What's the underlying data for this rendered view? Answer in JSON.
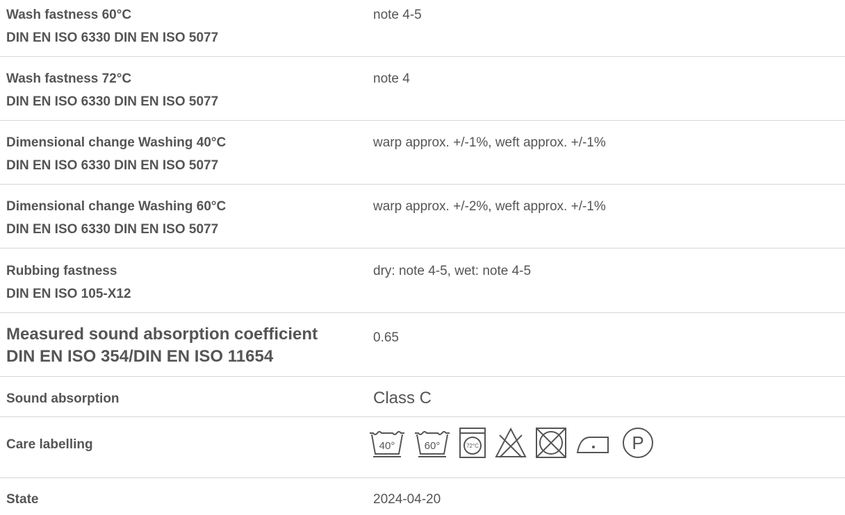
{
  "rows": [
    {
      "label1": "Wash fastness 60°C",
      "label2": "DIN EN ISO 6330 DIN EN ISO 5077",
      "value": "note 4-5"
    },
    {
      "label1": "Wash fastness 72°C",
      "label2": "DIN EN ISO 6330 DIN EN ISO 5077",
      "value": "note 4"
    },
    {
      "label1": "Dimensional change Washing 40°C",
      "label2": "DIN EN ISO 6330 DIN EN ISO 5077",
      "value": "warp approx. +/-1%, weft approx. +/-1%"
    },
    {
      "label1": "Dimensional change Washing 60°C",
      "label2": "DIN EN ISO 6330 DIN EN ISO 5077",
      "value": "warp approx. +/-2%, weft approx. +/-1%"
    },
    {
      "label1": "Rubbing fastness",
      "label2": "DIN EN ISO 105-X12",
      "value": "dry: note 4-5, wet: note 4-5"
    },
    {
      "label1": "Measured sound absorption coefficient",
      "label2": "DIN EN ISO 354/DIN EN ISO 11654",
      "value": "0.65"
    },
    {
      "label1": "Sound absorption",
      "value": "Class C"
    },
    {
      "label1": "Care labelling"
    },
    {
      "label1": "State",
      "value": "2024-04-20"
    }
  ],
  "care_icons": [
    {
      "name": "wash-40-icon",
      "text": "40°"
    },
    {
      "name": "wash-60-icon",
      "text": "60°"
    },
    {
      "name": "tumble-dry-72-icon",
      "text": "72°C"
    },
    {
      "name": "do-not-bleach-icon"
    },
    {
      "name": "do-not-tumble-dry-icon"
    },
    {
      "name": "iron-low-heat-icon"
    },
    {
      "name": "professional-dry-clean-p-icon",
      "text": "P"
    }
  ],
  "colors": {
    "text": "#555555",
    "separator": "#d6d6d6",
    "background": "#ffffff"
  }
}
